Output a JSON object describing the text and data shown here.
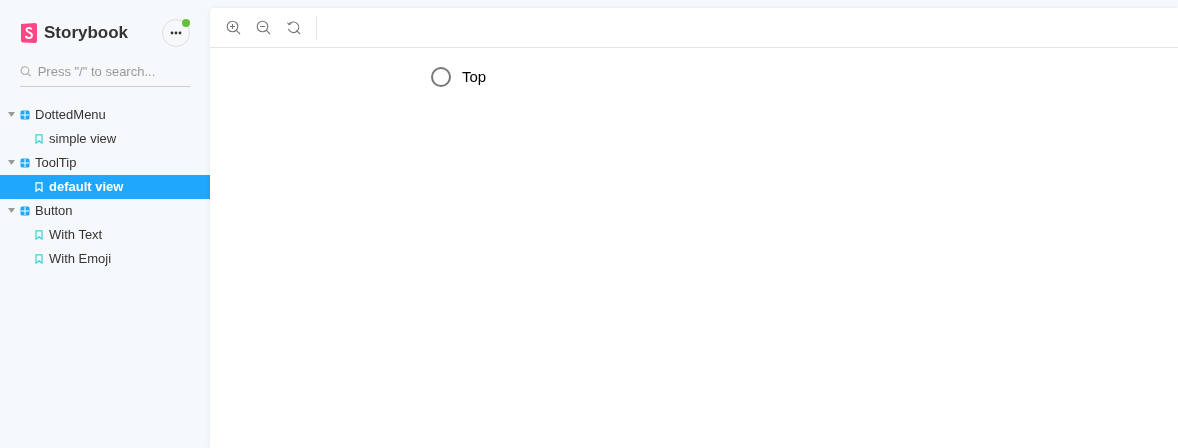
{
  "sidebar": {
    "brand": "Storybook",
    "search": {
      "placeholder": "Press \"/\" to search..."
    },
    "tree": [
      {
        "label": "DottedMenu",
        "expanded": true,
        "children": [
          {
            "label": "simple view",
            "selected": false
          }
        ]
      },
      {
        "label": "ToolTip",
        "expanded": true,
        "children": [
          {
            "label": "default view",
            "selected": true
          }
        ]
      },
      {
        "label": "Button",
        "expanded": true,
        "children": [
          {
            "label": "With Text",
            "selected": false
          },
          {
            "label": "With Emoji",
            "selected": false
          }
        ]
      }
    ]
  },
  "preview": {
    "label": "Top"
  }
}
